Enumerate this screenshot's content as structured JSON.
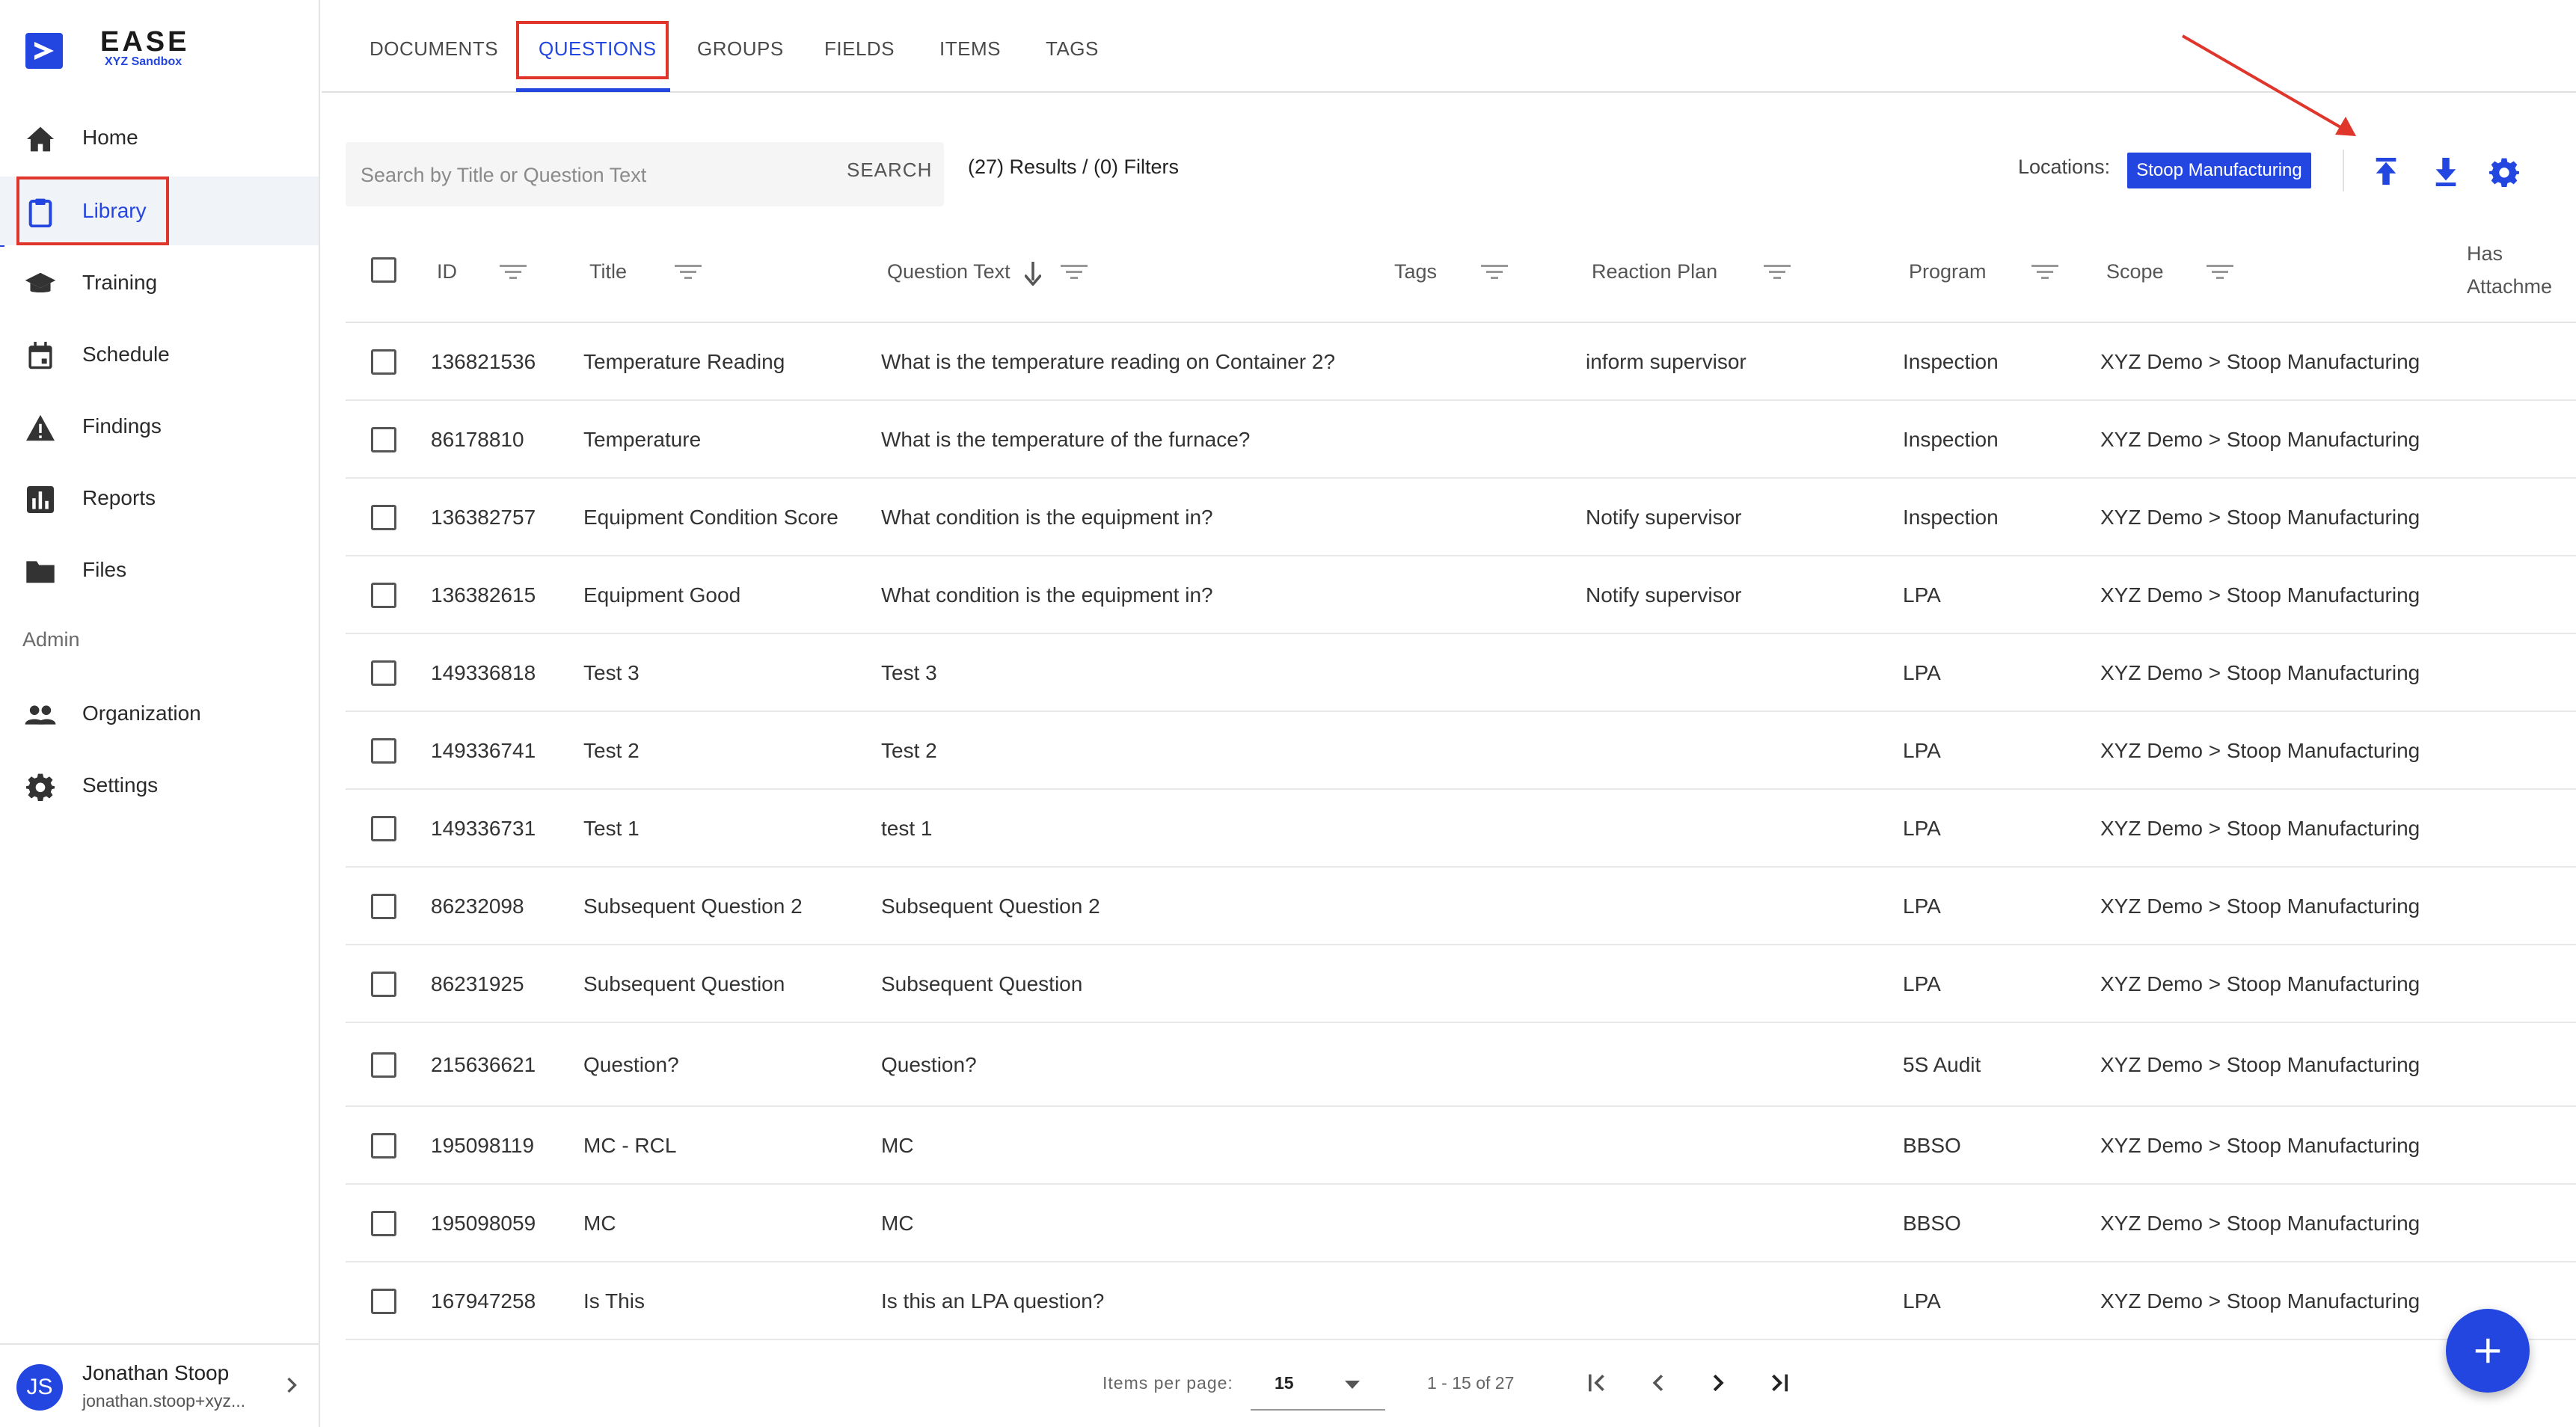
{
  "brand": {
    "name": "EASE",
    "subtitle": "XYZ Sandbox"
  },
  "sidebar": {
    "items": [
      {
        "label": "Home",
        "icon": "home-icon"
      },
      {
        "label": "Library",
        "icon": "clipboard-icon",
        "active": true
      },
      {
        "label": "Training",
        "icon": "graduation-cap-icon"
      },
      {
        "label": "Schedule",
        "icon": "calendar-icon"
      },
      {
        "label": "Findings",
        "icon": "warning-icon"
      },
      {
        "label": "Reports",
        "icon": "bar-chart-icon"
      },
      {
        "label": "Files",
        "icon": "folder-icon"
      }
    ],
    "admin_label": "Admin",
    "admin_items": [
      {
        "label": "Organization",
        "icon": "people-icon"
      },
      {
        "label": "Settings",
        "icon": "gear-icon"
      }
    ]
  },
  "user": {
    "initials": "JS",
    "name": "Jonathan Stoop",
    "email": "jonathan.stoop+xyz..."
  },
  "tabs": [
    {
      "label": "DOCUMENTS"
    },
    {
      "label": "QUESTIONS",
      "active": true
    },
    {
      "label": "GROUPS"
    },
    {
      "label": "FIELDS"
    },
    {
      "label": "ITEMS"
    },
    {
      "label": "TAGS"
    }
  ],
  "toolbar": {
    "search_placeholder": "Search by Title or Question Text",
    "search_button": "SEARCH",
    "results_text": "(27) Results / (0) Filters",
    "locations_label": "Locations:",
    "location_chip": "Stoop Manufacturing",
    "icons": [
      "upload-icon",
      "download-icon",
      "settings-gear-icon"
    ]
  },
  "table": {
    "columns": [
      "ID",
      "Title",
      "Question Text",
      "Tags",
      "Reaction Plan",
      "Program",
      "Scope",
      "Has",
      "Attachme"
    ],
    "rows": [
      {
        "id": "136821536",
        "title": "Temperature Reading",
        "question": "What is the temperature reading on Container 2?",
        "tags": "",
        "reaction": "inform supervisor",
        "program": "Inspection",
        "scope": "XYZ Demo > Stoop Manufacturing"
      },
      {
        "id": "86178810",
        "title": "Temperature",
        "question": "What is the temperature of the furnace?",
        "tags": "",
        "reaction": "",
        "program": "Inspection",
        "scope": "XYZ Demo > Stoop Manufacturing"
      },
      {
        "id": "136382757",
        "title": "Equipment Condition Score",
        "question": "What condition is the equipment in?",
        "tags": "",
        "reaction": "Notify supervisor",
        "program": "Inspection",
        "scope": "XYZ Demo > Stoop Manufacturing"
      },
      {
        "id": "136382615",
        "title": "Equipment Good",
        "question": "What condition is the equipment in?",
        "tags": "",
        "reaction": "Notify supervisor",
        "program": "LPA",
        "scope": "XYZ Demo > Stoop Manufacturing"
      },
      {
        "id": "149336818",
        "title": "Test 3",
        "question": "Test 3",
        "tags": "",
        "reaction": "",
        "program": "LPA",
        "scope": "XYZ Demo > Stoop Manufacturing"
      },
      {
        "id": "149336741",
        "title": "Test 2",
        "question": "Test 2",
        "tags": "",
        "reaction": "",
        "program": "LPA",
        "scope": "XYZ Demo > Stoop Manufacturing"
      },
      {
        "id": "149336731",
        "title": "Test 1",
        "question": "test 1",
        "tags": "",
        "reaction": "",
        "program": "LPA",
        "scope": "XYZ Demo > Stoop Manufacturing"
      },
      {
        "id": "86232098",
        "title": "Subsequent Question 2",
        "question": "Subsequent Question 2",
        "tags": "",
        "reaction": "",
        "program": "LPA",
        "scope": "XYZ Demo > Stoop Manufacturing"
      },
      {
        "id": "86231925",
        "title": "Subsequent Question",
        "question": "Subsequent Question",
        "tags": "",
        "reaction": "",
        "program": "LPA",
        "scope": "XYZ Demo > Stoop Manufacturing"
      },
      {
        "id": "215636621",
        "title": "Question?",
        "question": "Question?",
        "tags": "",
        "reaction": "",
        "program": "5S Audit",
        "scope": "XYZ Demo > Stoop Manufacturing"
      },
      {
        "id": "195098119",
        "title": "MC - RCL",
        "question": "MC",
        "tags": "",
        "reaction": "",
        "program": "BBSO",
        "scope": "XYZ Demo > Stoop Manufacturing"
      },
      {
        "id": "195098059",
        "title": "MC",
        "question": "MC",
        "tags": "",
        "reaction": "",
        "program": "BBSO",
        "scope": "XYZ Demo > Stoop Manufacturing"
      },
      {
        "id": "167947258",
        "title": "Is This",
        "question": "Is this an LPA question?",
        "tags": "",
        "reaction": "",
        "program": "LPA",
        "scope": "XYZ Demo > Stoop Manufacturing"
      }
    ]
  },
  "pagination": {
    "items_per_page_label": "Items per page:",
    "items_per_page": "15",
    "range": "1 - 15 of 27"
  },
  "colors": {
    "accent": "#2346e0",
    "annotation": "#e0352b"
  }
}
